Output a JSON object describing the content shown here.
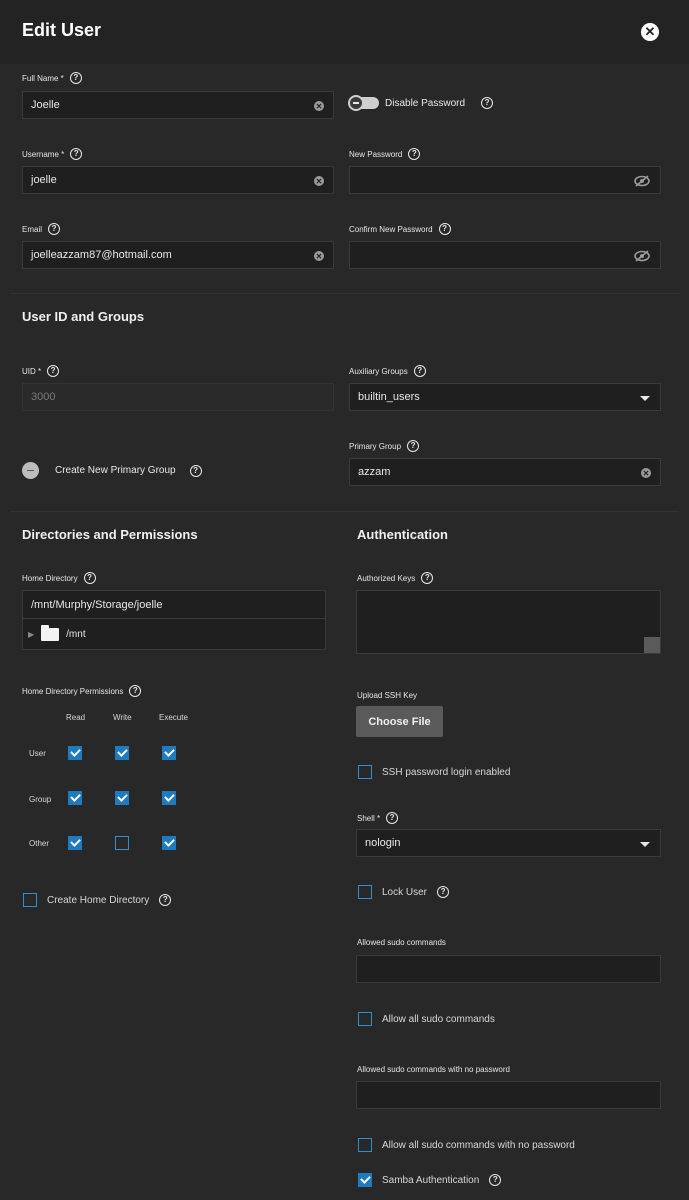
{
  "header": {
    "title": "Edit User"
  },
  "form": {
    "full_name": {
      "label": "Full Name *",
      "value": "Joelle"
    },
    "username": {
      "label": "Username *",
      "value": "joelle"
    },
    "email": {
      "label": "Email",
      "value": "joelleazzam87@hotmail.com"
    },
    "disable_password": {
      "label": "Disable Password"
    },
    "new_password": {
      "label": "New Password",
      "value": ""
    },
    "confirm_password": {
      "label": "Confirm New Password",
      "value": ""
    }
  },
  "user_id_groups": {
    "title": "User ID and Groups",
    "uid": {
      "label": "UID *",
      "value": "3000"
    },
    "aux_groups": {
      "label": "Auxiliary Groups",
      "value": "builtin_users"
    },
    "create_primary_group": {
      "label": "Create New Primary Group"
    },
    "primary_group": {
      "label": "Primary Group",
      "value": "azzam"
    }
  },
  "directories": {
    "title": "Directories and Permissions",
    "home_dir": {
      "label": "Home Directory",
      "value": "/mnt/Murphy/Storage/joelle"
    },
    "tree": {
      "node": "/mnt"
    },
    "permissions": {
      "label": "Home Directory Permissions",
      "columns": [
        "Read",
        "Write",
        "Execute"
      ],
      "rows": [
        {
          "name": "User",
          "read": true,
          "write": true,
          "execute": true
        },
        {
          "name": "Group",
          "read": true,
          "write": true,
          "execute": true
        },
        {
          "name": "Other",
          "read": true,
          "write": false,
          "execute": true
        }
      ]
    },
    "create_home_dir": {
      "label": "Create Home Directory",
      "checked": false
    }
  },
  "authentication": {
    "title": "Authentication",
    "authorized_keys": {
      "label": "Authorized Keys"
    },
    "upload_ssh": {
      "label": "Upload SSH Key",
      "button": "Choose File"
    },
    "ssh_password_login": {
      "label": "SSH password login enabled",
      "checked": false
    },
    "shell": {
      "label": "Shell *",
      "value": "nologin"
    },
    "lock_user": {
      "label": "Lock User",
      "checked": false
    },
    "sudo_commands": {
      "label": "Allowed sudo commands",
      "value": ""
    },
    "allow_all_sudo": {
      "label": "Allow all sudo commands",
      "checked": false
    },
    "sudo_nopasswd": {
      "label": "Allowed sudo commands with no password",
      "value": ""
    },
    "allow_all_sudo_nopasswd": {
      "label": "Allow all sudo commands with no password",
      "checked": false
    },
    "samba_auth": {
      "label": "Samba Authentication",
      "checked": true
    }
  }
}
